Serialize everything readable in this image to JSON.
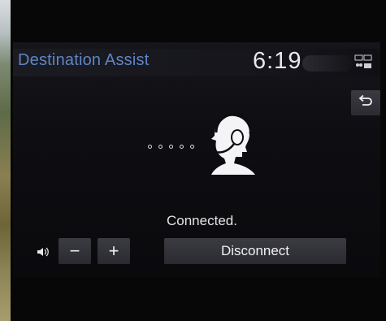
{
  "header": {
    "title": "Destination Assist",
    "clock": "6:19"
  },
  "call": {
    "status": "Connected."
  },
  "controls": {
    "volume_down_label": "−",
    "volume_up_label": "+",
    "disconnect_label": "Disconnect"
  },
  "icons": {
    "back": "back-arrow-icon",
    "speaker": "speaker-icon",
    "operator": "headset-operator-icon",
    "status": "connectivity-status-icon"
  },
  "colors": {
    "title": "#5f86c8",
    "button": "#34343a",
    "text": "#e8e8ea"
  }
}
